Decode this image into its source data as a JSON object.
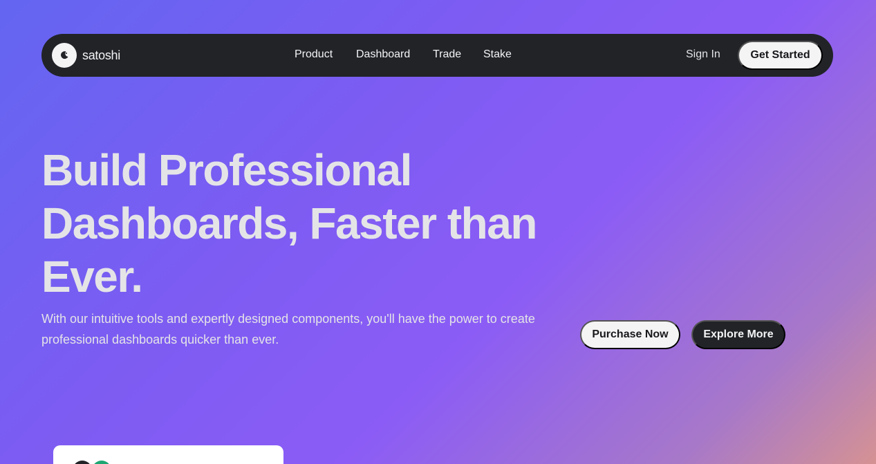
{
  "brand": {
    "name": "satoshi",
    "icon": "moon-icon"
  },
  "nav": {
    "links": [
      {
        "label": "Product"
      },
      {
        "label": "Dashboard"
      },
      {
        "label": "Trade"
      },
      {
        "label": "Stake"
      }
    ],
    "sign_in": "Sign In",
    "get_started": "Get Started"
  },
  "hero": {
    "title": "Build Professional Dashboards, Faster than Ever.",
    "subtitle": "With our intuitive tools and expertly designed components, you'll have the power to create professional dashboards quicker than ever.",
    "primary_cta": "Purchase Now",
    "secondary_cta": "Explore More"
  },
  "colors": {
    "gradient_start": "#6366f1",
    "gradient_mid": "#8b5cf6",
    "gradient_end": "#d59293",
    "navbar_bg": "#212327",
    "light_button": "#f4f4f5"
  }
}
